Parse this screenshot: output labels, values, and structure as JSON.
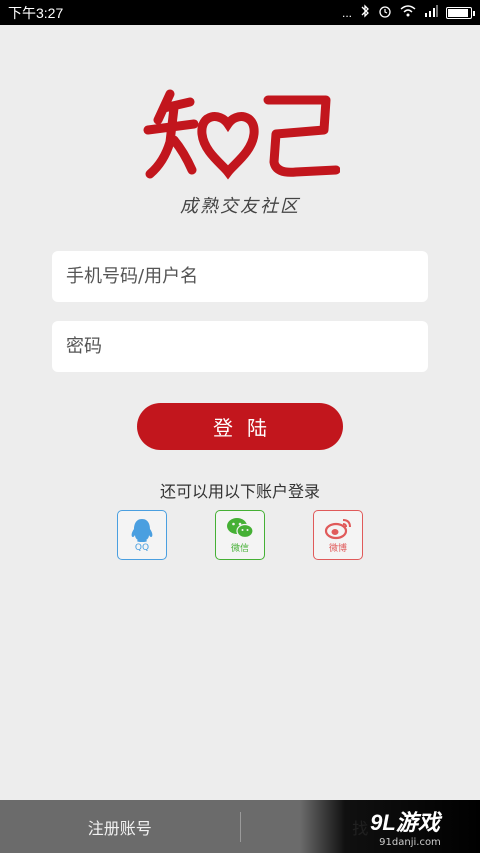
{
  "status_bar": {
    "time": "下午3:27",
    "signal_dots": "...",
    "battery_level": 0.9
  },
  "logo": {
    "text": "知己",
    "brand_color": "#c2161d"
  },
  "slogan": "成熟交友社区",
  "form": {
    "username_placeholder": "手机号码/用户名",
    "password_placeholder": "密码",
    "login_label": "登陆"
  },
  "alt_login": {
    "prompt": "还可以用以下账户登录",
    "providers": [
      {
        "label": "QQ",
        "icon": "qq-penguin-icon",
        "color": "#4a9fe0"
      },
      {
        "label": "微信",
        "icon": "wechat-icon",
        "color": "#45b035"
      },
      {
        "label": "微博",
        "icon": "weibo-icon",
        "color": "#e05a5a"
      }
    ]
  },
  "bottom_bar": {
    "register_label": "注册账号",
    "right_label": "找"
  },
  "watermark": {
    "main": "9L游戏",
    "sub": "91danji.com"
  }
}
